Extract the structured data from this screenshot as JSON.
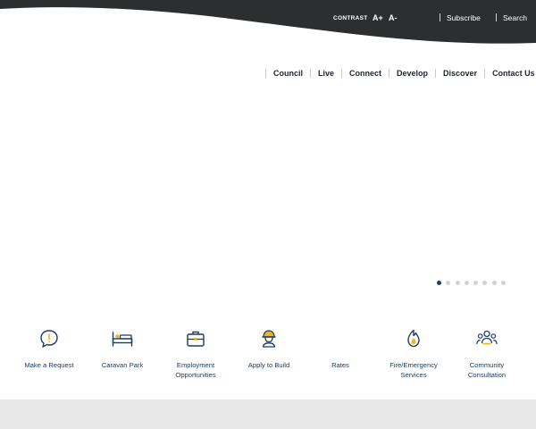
{
  "colors": {
    "topbar_bg": "#2d2e30",
    "nav_text": "#1f2430",
    "accent": "#1d3d63",
    "fire_accent": "#f2b418",
    "footer_bg": "#e8e8e8"
  },
  "utility_bar": {
    "contrast_label": "CONTRAST",
    "font_increase_label": "A+",
    "font_decrease_label": "A-",
    "subscribe_label": "Subscribe",
    "search_label": "Search"
  },
  "main_nav": {
    "items": [
      {
        "label": "Council"
      },
      {
        "label": "Live"
      },
      {
        "label": "Connect"
      },
      {
        "label": "Develop"
      },
      {
        "label": "Discover"
      },
      {
        "label": "Contact Us"
      }
    ]
  },
  "carousel": {
    "slide_count": 8,
    "active_index": 0
  },
  "quick_links": [
    {
      "label": "Make a Request",
      "icon": "chat-bubble-exclamation-icon"
    },
    {
      "label": "Caravan Park",
      "icon": "bed-icon"
    },
    {
      "label": "Employment Opportunities",
      "icon": "briefcase-icon"
    },
    {
      "label": "Apply to Build",
      "icon": "hardhat-worker-icon"
    },
    {
      "label": "Rates",
      "icon": ""
    },
    {
      "label": "Fire/Emergency Services",
      "icon": "flame-shield-icon"
    },
    {
      "label": "Community Consultation",
      "icon": "people-group-icon"
    }
  ]
}
